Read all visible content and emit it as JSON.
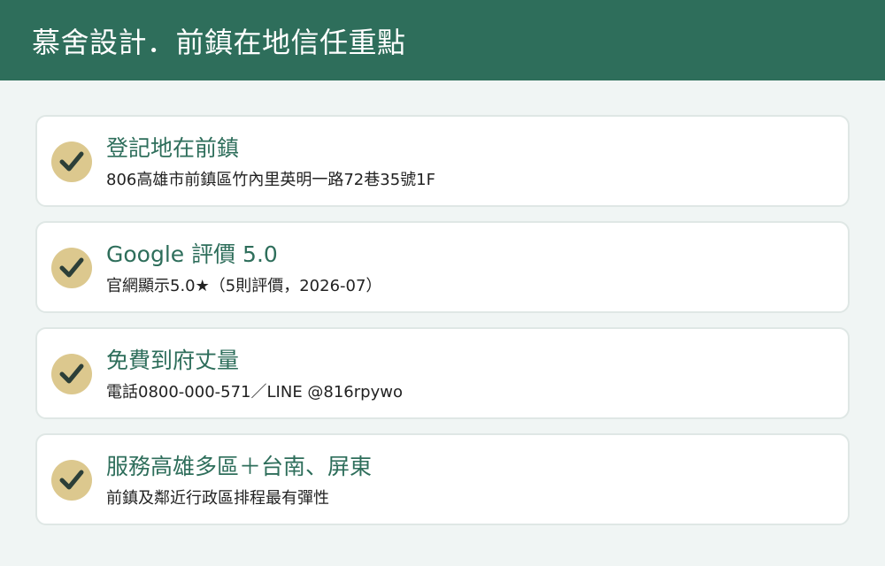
{
  "header": {
    "title": "慕舍設計．前鎮在地信任重點"
  },
  "items": [
    {
      "icon": "check-icon",
      "title": "登記地在前鎮",
      "subtitle": "806高雄市前鎮區竹內里英明一路72巷35號1F"
    },
    {
      "icon": "check-icon",
      "title": "Google 評價 5.0",
      "subtitle": "官網顯示5.0★（5則評價，2026-07）"
    },
    {
      "icon": "check-icon",
      "title": "免費到府丈量",
      "subtitle": "電話0800-000-571／LINE @816rpywo"
    },
    {
      "icon": "check-icon",
      "title": "服務高雄多區＋台南、屏東",
      "subtitle": "前鎮及鄰近行政區排程最有彈性"
    }
  ],
  "colors": {
    "header_bg": "#2e6e5b",
    "accent": "#2e6e5b",
    "check_bg": "#dcc88e",
    "check_mark": "#2c3f38",
    "page_bg": "#f0f5f4"
  }
}
